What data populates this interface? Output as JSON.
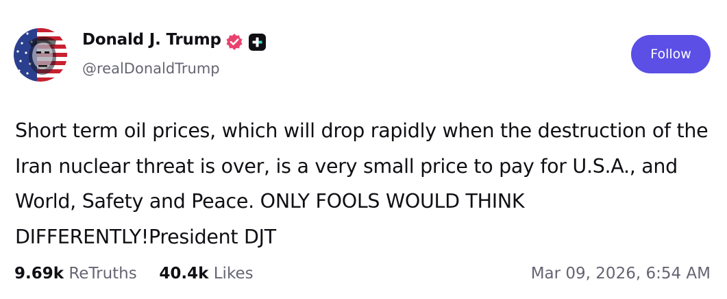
{
  "author": {
    "display_name": "Donald J. Trump",
    "handle": "@realDonaldTrump",
    "avatar_icon": "flag-portrait-avatar",
    "verified_icon": "verified-badge-icon",
    "verified_color": "#e8436e",
    "plus_icon": "plus-badge-icon"
  },
  "follow_button": {
    "label": "Follow",
    "color": "#5b4fe6"
  },
  "post": {
    "text": "Short term oil prices, which will drop rapidly when the destruction of the Iran nuclear threat is over, is a very small price to pay for U.S.A., and World, Safety and Peace. ONLY FOOLS WOULD THINK DIFFERENTLY!President DJT"
  },
  "stats": {
    "retruths_count": "9.69k",
    "retruths_label": "ReTruths",
    "likes_count": "40.4k",
    "likes_label": "Likes"
  },
  "timestamp": "Mar 09, 2026, 6:54 AM"
}
